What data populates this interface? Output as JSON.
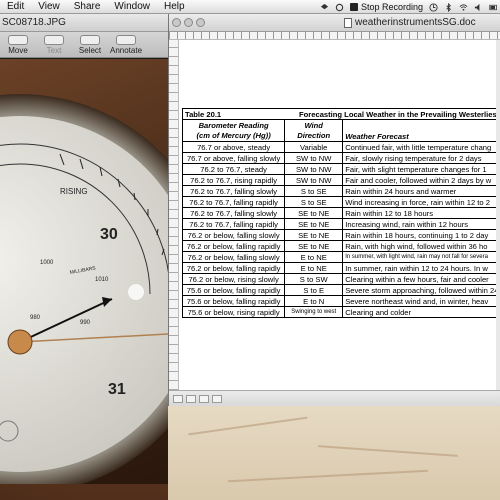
{
  "menubar": {
    "items": [
      "Edit",
      "View",
      "Share",
      "Window",
      "Help"
    ],
    "record_label": "Stop Recording"
  },
  "preview": {
    "title": "SC08718.JPG",
    "toolbar": [
      "Move",
      "Text",
      "Select",
      "Annotate"
    ],
    "barometer": {
      "label_rising": "RISING",
      "num_30": "30",
      "num_31": "31",
      "ticks": [
        "1000",
        "1010",
        "980",
        "990"
      ],
      "unit_label": "MILLIBARS"
    }
  },
  "document": {
    "title": "weatherinstrumentsSG.doc",
    "table": {
      "caption_left": "Table 20.1",
      "caption_right": "Forecasting Local Weather in the Prevailing Westerlies",
      "headers": [
        "Barometer Reading (cm of Mercury (Hg))",
        "Wind Direction",
        "Weather Forecast"
      ],
      "header_lines": {
        "col1_a": "Barometer Reading",
        "col1_b": "(cm of Mercury (Hg))",
        "col2_a": "Wind",
        "col2_b": "Direction",
        "col3": "Weather Forecast"
      },
      "rows": [
        [
          "76.7 or above, steady",
          "Variable",
          "Continued fair, with little temperature chang"
        ],
        [
          "76.7 or above, falling slowly",
          "SW to NW",
          "Fair, slowly rising temperature for 2 days"
        ],
        [
          "76.2 to 76.7, steady",
          "SW to NW",
          "Fair, with slight temperature changes for 1"
        ],
        [
          "76.2 to 76.7, rising rapidly",
          "SW to NW",
          "Fair and cooler, followed within 2 days by w"
        ],
        [
          "76.2 to 76.7, falling slowly",
          "S to SE",
          "Rain within 24 hours and warmer"
        ],
        [
          "76.2 to 76.7, falling rapidly",
          "S to SE",
          "Wind increasing in force, rain within 12 to 2"
        ],
        [
          "76.2 to 76.7, falling slowly",
          "SE to NE",
          "Rain within 12 to 18 hours"
        ],
        [
          "76.2 to 76.7, falling rapidly",
          "SE to NE",
          "Increasing wind, rain within 12 hours"
        ],
        [
          "76.2 or below, falling slowly",
          "SE to NE",
          "Rain within 18 hours, continuing 1 to 2 day"
        ],
        [
          "76.2 or below, falling rapidly",
          "SE to NE",
          "Rain, with high wind, followed within 36 ho"
        ],
        [
          "76.2 or below, falling slowly",
          "E to NE",
          "In summer, with light wind, rain may not fall for severa"
        ],
        [
          "76.2 or below, falling rapidly",
          "E to NE",
          "In summer, rain within 12 to 24 hours. In w"
        ],
        [
          "76.2 or below, rising slowly",
          "S to SW",
          "Clearing within a few hours, fair and cooler"
        ],
        [
          "75.6 or below, falling rapidly",
          "S to E",
          "Severe storm approaching, followed within 24 ho"
        ],
        [
          "75.6 or below, falling rapidly",
          "E to N",
          "Severe northeast wind and, in winter, heav"
        ],
        [
          "75.6 or below, rising rapidly",
          "Swinging to west",
          "Clearing and colder"
        ]
      ]
    }
  }
}
